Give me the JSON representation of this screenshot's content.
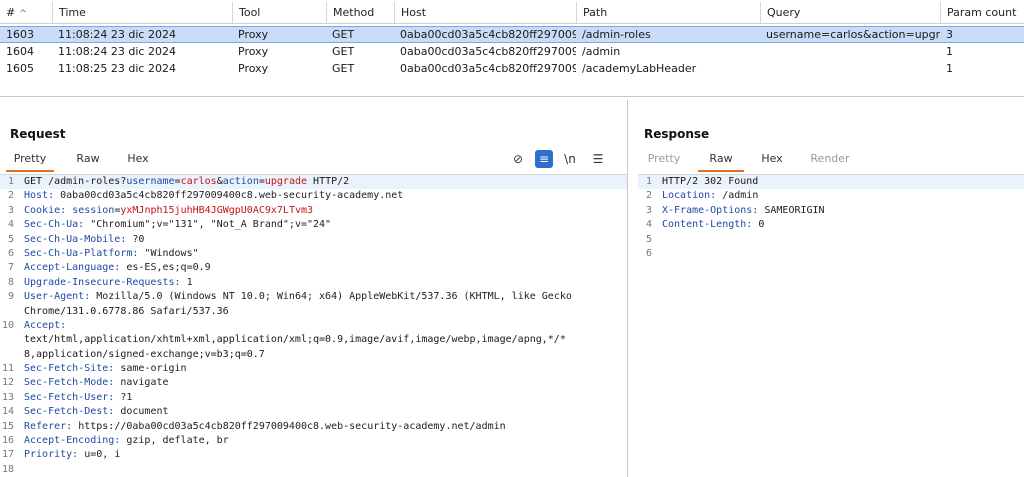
{
  "history": {
    "columns": {
      "num": "#",
      "time": "Time",
      "tool": "Tool",
      "method": "Method",
      "host": "Host",
      "path": "Path",
      "query": "Query",
      "param_count": "Param count"
    },
    "rows": [
      {
        "num": "1603",
        "time": "11:08:24 23 dic 2024",
        "tool": "Proxy",
        "method": "GET",
        "host": "0aba00cd03a5c4cb820ff2970094...",
        "path": "/admin-roles",
        "query": "username=carlos&action=upgra...",
        "param_count": "3",
        "selected": true
      },
      {
        "num": "1604",
        "time": "11:08:24 23 dic 2024",
        "tool": "Proxy",
        "method": "GET",
        "host": "0aba00cd03a5c4cb820ff2970094...",
        "path": "/admin",
        "query": "",
        "param_count": "1",
        "selected": false
      },
      {
        "num": "1605",
        "time": "11:08:25 23 dic 2024",
        "tool": "Proxy",
        "method": "GET",
        "host": "0aba00cd03a5c4cb820ff2970094...",
        "path": "/academyLabHeader",
        "query": "",
        "param_count": "1",
        "selected": false
      }
    ]
  },
  "request": {
    "title": "Request",
    "tabs": [
      "Pretty",
      "Raw",
      "Hex"
    ],
    "active_tab": "Pretty",
    "toolbar_icons": [
      "eye-off-icon",
      "wrap-lines-icon",
      "newline-icon",
      "menu-icon"
    ],
    "toolbar_glyphs": [
      "⊘",
      "≡",
      "\\n",
      "☰"
    ],
    "line1": {
      "pre": "GET /admin-roles?",
      "p1_name": "username",
      "p1_val": "carlos",
      "amp": "&",
      "p2_name": "action",
      "p2_val": "upgrade",
      "post": " HTTP/2"
    },
    "cookie": {
      "name": "Cookie:",
      "key": "session",
      "value": "yxMJnph15juhHB4JGWgpU0AC9x7LTvm3"
    },
    "headers": [
      {
        "n": "2",
        "name": "Host:",
        "value": "0aba00cd03a5c4cb820ff297009400c8.web-security-academy.net"
      },
      {
        "n": "4",
        "name": "Sec-Ch-Ua:",
        "value": "\"Chromium\";v=\"131\", \"Not_A Brand\";v=\"24\""
      },
      {
        "n": "5",
        "name": "Sec-Ch-Ua-Mobile:",
        "value": "?0"
      },
      {
        "n": "6",
        "name": "Sec-Ch-Ua-Platform:",
        "value": "\"Windows\""
      },
      {
        "n": "7",
        "name": "Accept-Language:",
        "value": "es-ES,es;q=0.9"
      },
      {
        "n": "8",
        "name": "Upgrade-Insecure-Requests:",
        "value": "1"
      }
    ],
    "user_agent": {
      "name": "User-Agent:",
      "value": "Mozilla/5.0 (Windows NT 10.0; Win64; x64) AppleWebKit/537.36 (KHTML, like Gecko",
      "cont": "Chrome/131.0.6778.86 Safari/537.36"
    },
    "accept": {
      "name": "Accept:",
      "cont1": "text/html,application/xhtml+xml,application/xml;q=0.9,image/avif,image/webp,image/apng,*/*",
      "cont2": "8,application/signed-exchange;v=b3;q=0.7"
    },
    "headers2": [
      {
        "n": "11",
        "name": "Sec-Fetch-Site:",
        "value": "same-origin"
      },
      {
        "n": "12",
        "name": "Sec-Fetch-Mode:",
        "value": "navigate"
      },
      {
        "n": "13",
        "name": "Sec-Fetch-User:",
        "value": "?1"
      },
      {
        "n": "14",
        "name": "Sec-Fetch-Dest:",
        "value": "document"
      },
      {
        "n": "15",
        "name": "Referer:",
        "value": "https://0aba00cd03a5c4cb820ff297009400c8.web-security-academy.net/admin"
      },
      {
        "n": "16",
        "name": "Accept-Encoding:",
        "value": "gzip, deflate, br"
      },
      {
        "n": "17",
        "name": "Priority:",
        "value": "u=0, i"
      }
    ],
    "last_line_num": "18"
  },
  "response": {
    "title": "Response",
    "tabs": [
      "Pretty",
      "Raw",
      "Hex",
      "Render"
    ],
    "active_tab": "Raw",
    "status_line": "HTTP/2 302 Found",
    "headers": [
      {
        "n": "2",
        "name": "Location:",
        "value": "/admin"
      },
      {
        "n": "3",
        "name": "X-Frame-Options:",
        "value": "SAMEORIGIN"
      },
      {
        "n": "4",
        "name": "Content-Length:",
        "value": "0"
      }
    ],
    "empty_lines": [
      "5",
      "6"
    ]
  }
}
